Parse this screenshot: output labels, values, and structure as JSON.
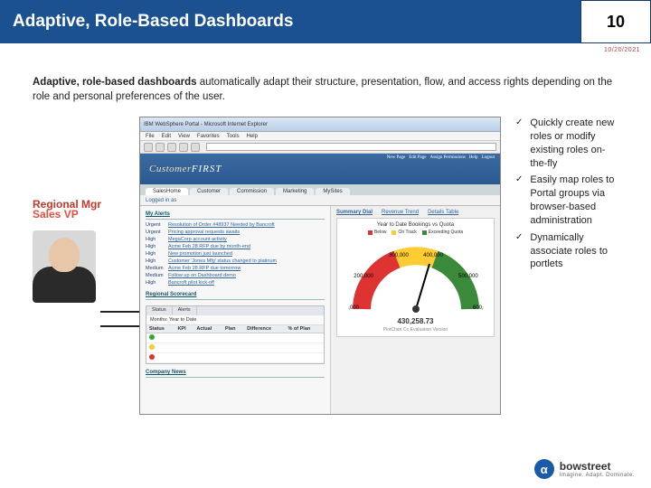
{
  "header": {
    "title": "Adaptive, Role-Based Dashboards",
    "page_number": "10",
    "date": "10/20/2021"
  },
  "intro": {
    "bold_lead": "Adaptive, role-based dashboards",
    "rest": " automatically adapt their structure, presentation, flow, and access rights depending on the role and personal preferences of the user."
  },
  "roles": [
    "Regional Mgr",
    "Sales VP"
  ],
  "bullets": [
    "Quickly create new roles or modify existing roles on-the-fly",
    "Easily map roles to Portal groups via browser-based administration",
    "Dynamically associate roles to portlets"
  ],
  "screenshot": {
    "window_title": "IBM WebSphere Portal - Microsoft Internet Explorer",
    "menu": [
      "File",
      "Edit",
      "View",
      "Favorites",
      "Tools",
      "Help"
    ],
    "top_links": [
      "New Page",
      "Edit Page",
      "Assign Permissions",
      "Help",
      "Logout"
    ],
    "brand1": "Customer",
    "brand2": "FIRST",
    "tabs": [
      "SalesHome",
      "Customer",
      "Commission",
      "Marketing",
      "MySites"
    ],
    "subrow_user": "Logged in as",
    "sec_alerts": "My Alerts",
    "alerts": [
      {
        "pri": "Urgent",
        "txt": "Resolution of Order #48937 Needed by Bancroft"
      },
      {
        "pri": "Urgent",
        "txt": "Pricing approval requests awaits"
      },
      {
        "pri": "High",
        "txt": "MegaCorp account activity"
      },
      {
        "pri": "High",
        "txt": "Acme Feb 28 RFP due by month-end"
      },
      {
        "pri": "High",
        "txt": "New promotion just launched"
      },
      {
        "pri": "High",
        "txt": "Customer 'Jones Mfg' status changed to platinum"
      },
      {
        "pri": "Medium",
        "txt": "Acme Feb 28 RFP due tomorrow"
      },
      {
        "pri": "Medium",
        "txt": "Follow up on Dashboard demo"
      },
      {
        "pri": "High",
        "txt": "Bancroft pilot kick-off"
      }
    ],
    "sec_scorecard": "Regional Scorecard",
    "sc_tabs": [
      "Status",
      "Alerts"
    ],
    "sc_filter_label": "Months:",
    "sc_filter_val": "Year to Date",
    "sc_cols": [
      "Status",
      "KPI",
      "Actual",
      "Plan",
      "Difference",
      "% of Plan"
    ],
    "sec_news": "Company News",
    "right_links": [
      "Summary Dial",
      "Revenue Trend",
      "Details Table"
    ],
    "gauge_title": "Year to Date Bookings vs Quota",
    "gauge_legend": [
      "Below",
      "On Track",
      "Exceeding Quota"
    ]
  },
  "chart_data": {
    "type": "gauge",
    "title": "Year to Date Bookings vs Quota",
    "value": 430258.73,
    "value_display": "430,258.73",
    "min": 100000,
    "max": 650000,
    "ticks": [
      100000,
      200000,
      300000,
      400000,
      500000,
      600000
    ],
    "bands": [
      {
        "name": "Below",
        "color": "#d33",
        "from": 100000,
        "to": 300000
      },
      {
        "name": "On Track",
        "color": "#fc3",
        "from": 300000,
        "to": 450000
      },
      {
        "name": "Exceeding Quota",
        "color": "#3b8a3b",
        "from": 450000,
        "to": 650000
      }
    ],
    "footnote": "PlotChart Co Evaluation Version"
  },
  "footer": {
    "logo_text": "bowstreet",
    "tagline": "Imagine. Adapt. Dominate."
  }
}
